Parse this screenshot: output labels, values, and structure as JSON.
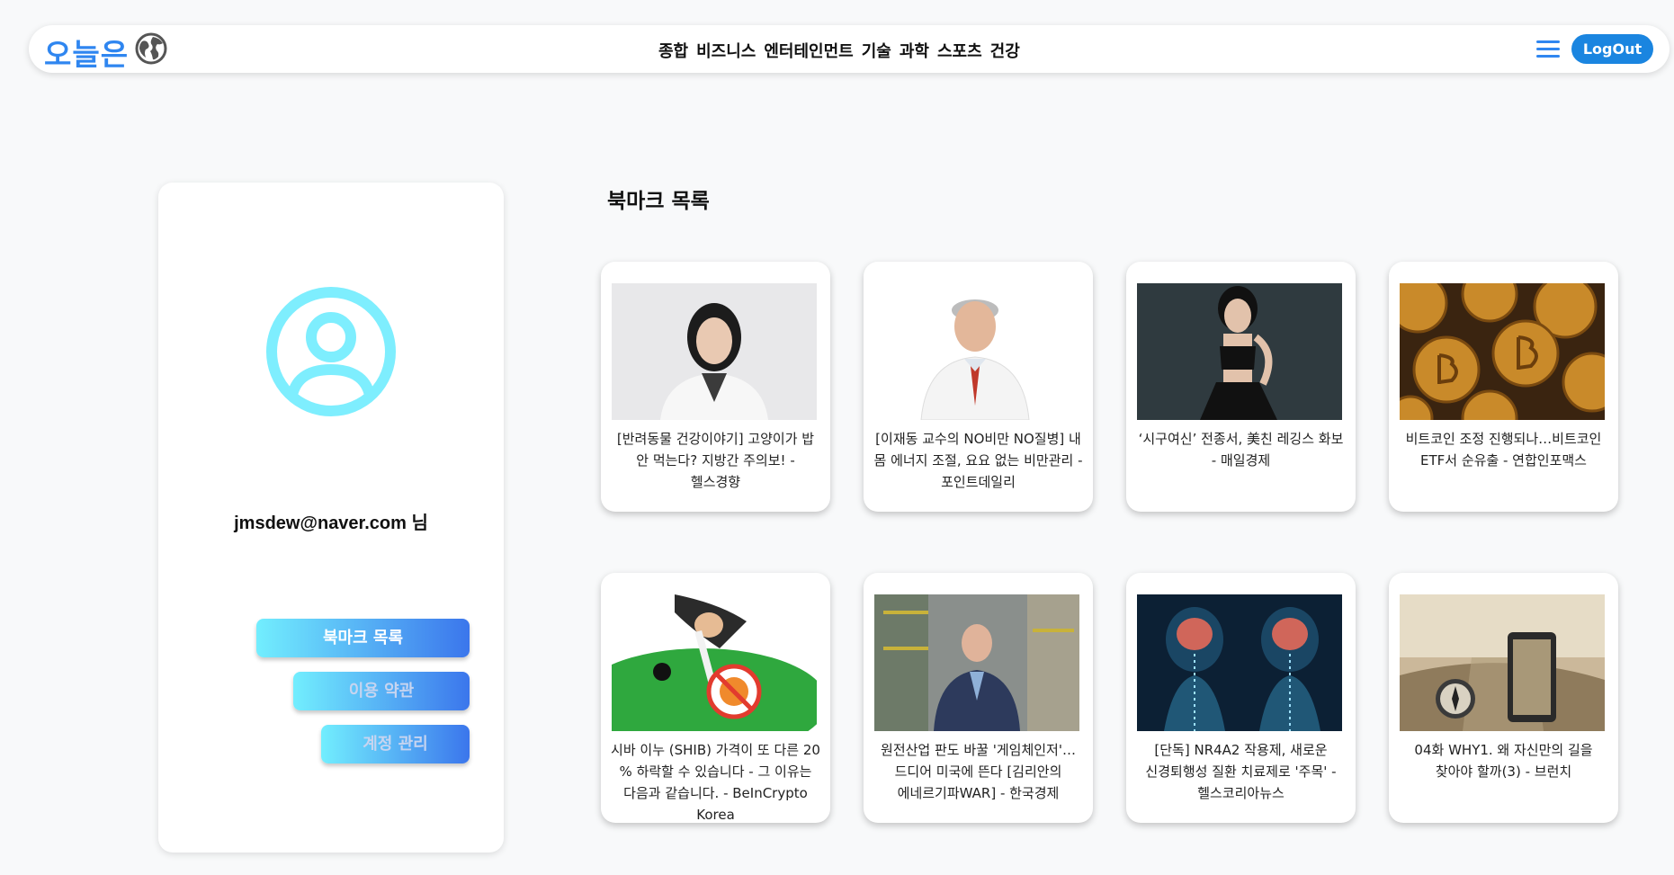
{
  "header": {
    "logo": "오늘은",
    "nav": [
      "종합",
      "비즈니스",
      "엔터테인먼트",
      "기술",
      "과학",
      "스포츠",
      "건강"
    ],
    "logout_label": "LogOut"
  },
  "profile": {
    "email": "jmsdew@naver.com 님",
    "buttons": [
      "북마크 목록",
      "이용 약관",
      "계정 관리"
    ]
  },
  "bookmarks": {
    "title": "북마크 목록",
    "items": [
      {
        "title": "[반려동물 건강이야기] 고양이가 밥 안 먹는다? 지방간 주의보! - 헬스경향"
      },
      {
        "title": "[이재동 교수의 NO비만 NO질병] 내 몸 에너지 조절, 요요 없는 비만관리 - 포인트데일리"
      },
      {
        "title": "‘시구여신’ 전종서, 美친 레깅스 화보 - 매일경제"
      },
      {
        "title": "비트코인 조정 진행되나…비트코인 ETF서 순유출 - 연합인포맥스"
      },
      {
        "title": "시바 이누 (SHIB) 가격이 또 다른 20 % 하락할 수 있습니다 - 그 이유는 다음과 같습니다. - BeInCrypto Korea"
      },
      {
        "title": "원전산업 판도 바꿀 '게임체인저'… 드디어 미국에 뜬다 [김리안의 에네르기파WAR] - 한국경제"
      },
      {
        "title": "[단독] NR4A2 작용제, 새로운 신경퇴행성 질환 치료제로 '주목' - 헬스코리아뉴스"
      },
      {
        "title": "04화 WHY1. 왜 자신만의 길을 찾아야 할까(3) - 브런치"
      }
    ]
  }
}
